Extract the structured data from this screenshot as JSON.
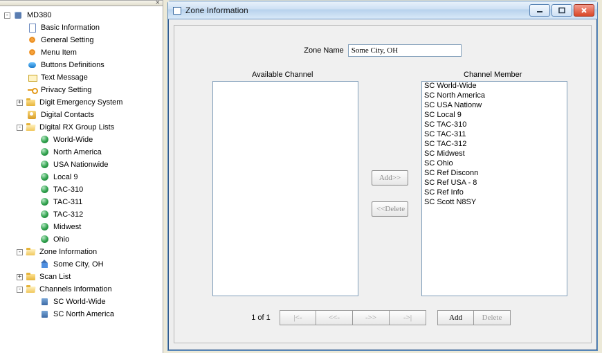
{
  "tree": {
    "root": "MD380",
    "items": [
      {
        "label": "Basic Information",
        "icon": "i-page"
      },
      {
        "label": "General Setting",
        "icon": "i-gear"
      },
      {
        "label": "Menu Item",
        "icon": "i-gear"
      },
      {
        "label": "Buttons Definitions",
        "icon": "i-button"
      },
      {
        "label": "Text Message",
        "icon": "i-msg"
      },
      {
        "label": "Privacy Setting",
        "icon": "i-key"
      },
      {
        "label": "Digit Emergency System",
        "icon": "i-folder",
        "expander": "+"
      },
      {
        "label": "Digital Contacts",
        "icon": "i-contacts"
      },
      {
        "label": "Digital RX Group Lists",
        "icon": "i-folder-open",
        "expander": "-",
        "children": [
          "World-Wide",
          "North America",
          "USA Nationwide",
          "Local 9",
          "TAC-310",
          "TAC-311",
          "TAC-312",
          "Midwest",
          "Ohio"
        ]
      },
      {
        "label": "Zone Information",
        "icon": "i-folder-open",
        "expander": "-",
        "children_custom": [
          {
            "label": "Some City, OH",
            "icon": "i-house"
          }
        ]
      },
      {
        "label": "Scan List",
        "icon": "i-folder",
        "expander": "+"
      },
      {
        "label": "Channels Information",
        "icon": "i-folder-open",
        "expander": "-",
        "children_custom": [
          {
            "label": "SC World-Wide",
            "icon": "i-radio"
          },
          {
            "label": "SC North America",
            "icon": "i-radio"
          }
        ]
      }
    ]
  },
  "window": {
    "title": "Zone Information",
    "zone_label": "Zone Name",
    "zone_value": "Some City, OH",
    "hdr_available": "Available Channel",
    "hdr_member": "Channel Member",
    "btn_add_move": "Add>>",
    "btn_del_move": "<<Delete",
    "pager_label": "1 of 1",
    "pager_first": "|<-",
    "pager_prev": "<<-",
    "pager_next": "->>",
    "pager_last": "->|",
    "pager_add": "Add",
    "pager_delete": "Delete",
    "available": [],
    "members": [
      "SC World-Wide",
      "SC North America",
      "SC USA Nationw",
      "SC Local 9",
      "SC TAC-310",
      "SC TAC-311",
      "SC TAC-312",
      "SC Midwest",
      "SC Ohio",
      "SC Ref Disconn",
      "SC Ref USA - 8",
      "SC Ref Info",
      "SC Scott N8SY"
    ]
  }
}
